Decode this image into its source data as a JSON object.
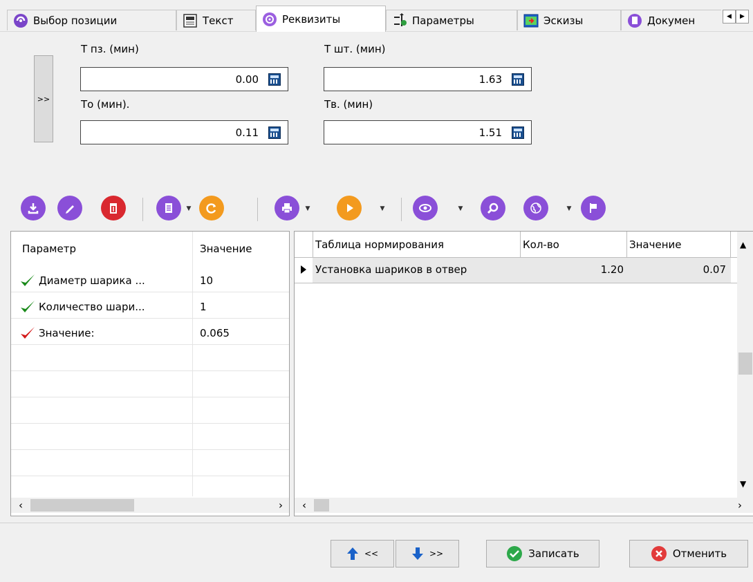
{
  "tabs": [
    {
      "label": "Выбор позиции",
      "icon": "position-select-icon"
    },
    {
      "label": "Текст",
      "icon": "text-document-icon"
    },
    {
      "label": "Реквизиты",
      "icon": "requisites-icon"
    },
    {
      "label": "Параметры",
      "icon": "parameters-icon"
    },
    {
      "label": "Эскизы",
      "icon": "sketches-icon"
    },
    {
      "label": "Докумен",
      "icon": "documents-icon"
    }
  ],
  "fields": {
    "t_pz": {
      "label": "Т пз. (мин)",
      "value": "0.00"
    },
    "t_sht": {
      "label": "Т шт. (мин)",
      "value": "1.63"
    },
    "t_o": {
      "label": "То (мин).",
      "value": "0.11"
    },
    "t_v": {
      "label": "Тв. (мин)",
      "value": "1.51"
    }
  },
  "side_button": ">>",
  "toolbar": {
    "colors": {
      "purple": "#8a4fd8",
      "red": "#d9282f",
      "orange": "#f39a1e"
    },
    "icons": [
      "import-icon",
      "edit-icon",
      "delete-icon",
      "document-icon",
      "refresh-icon",
      "print-icon",
      "play-icon",
      "view-icon",
      "search-icon",
      "globe-icon",
      "flag-icon"
    ]
  },
  "left_grid": {
    "headers": [
      "Параметр",
      "Значение"
    ],
    "rows": [
      {
        "name": "Диаметр шарика ...",
        "value": "10",
        "check": "green"
      },
      {
        "name": "Количество шари...",
        "value": "1",
        "check": "green"
      },
      {
        "name": "Значение:",
        "value": "0.065",
        "check": "red"
      }
    ]
  },
  "right_grid": {
    "headers": [
      "Таблица нормирования",
      "Кол-во",
      "Значение"
    ],
    "rows": [
      {
        "name": "Установка шариков в отвер",
        "qty": "1.20",
        "value": "0.07"
      }
    ]
  },
  "buttons": {
    "prev": "<<",
    "next": ">>",
    "save": "Записать",
    "cancel": "Отменить"
  }
}
